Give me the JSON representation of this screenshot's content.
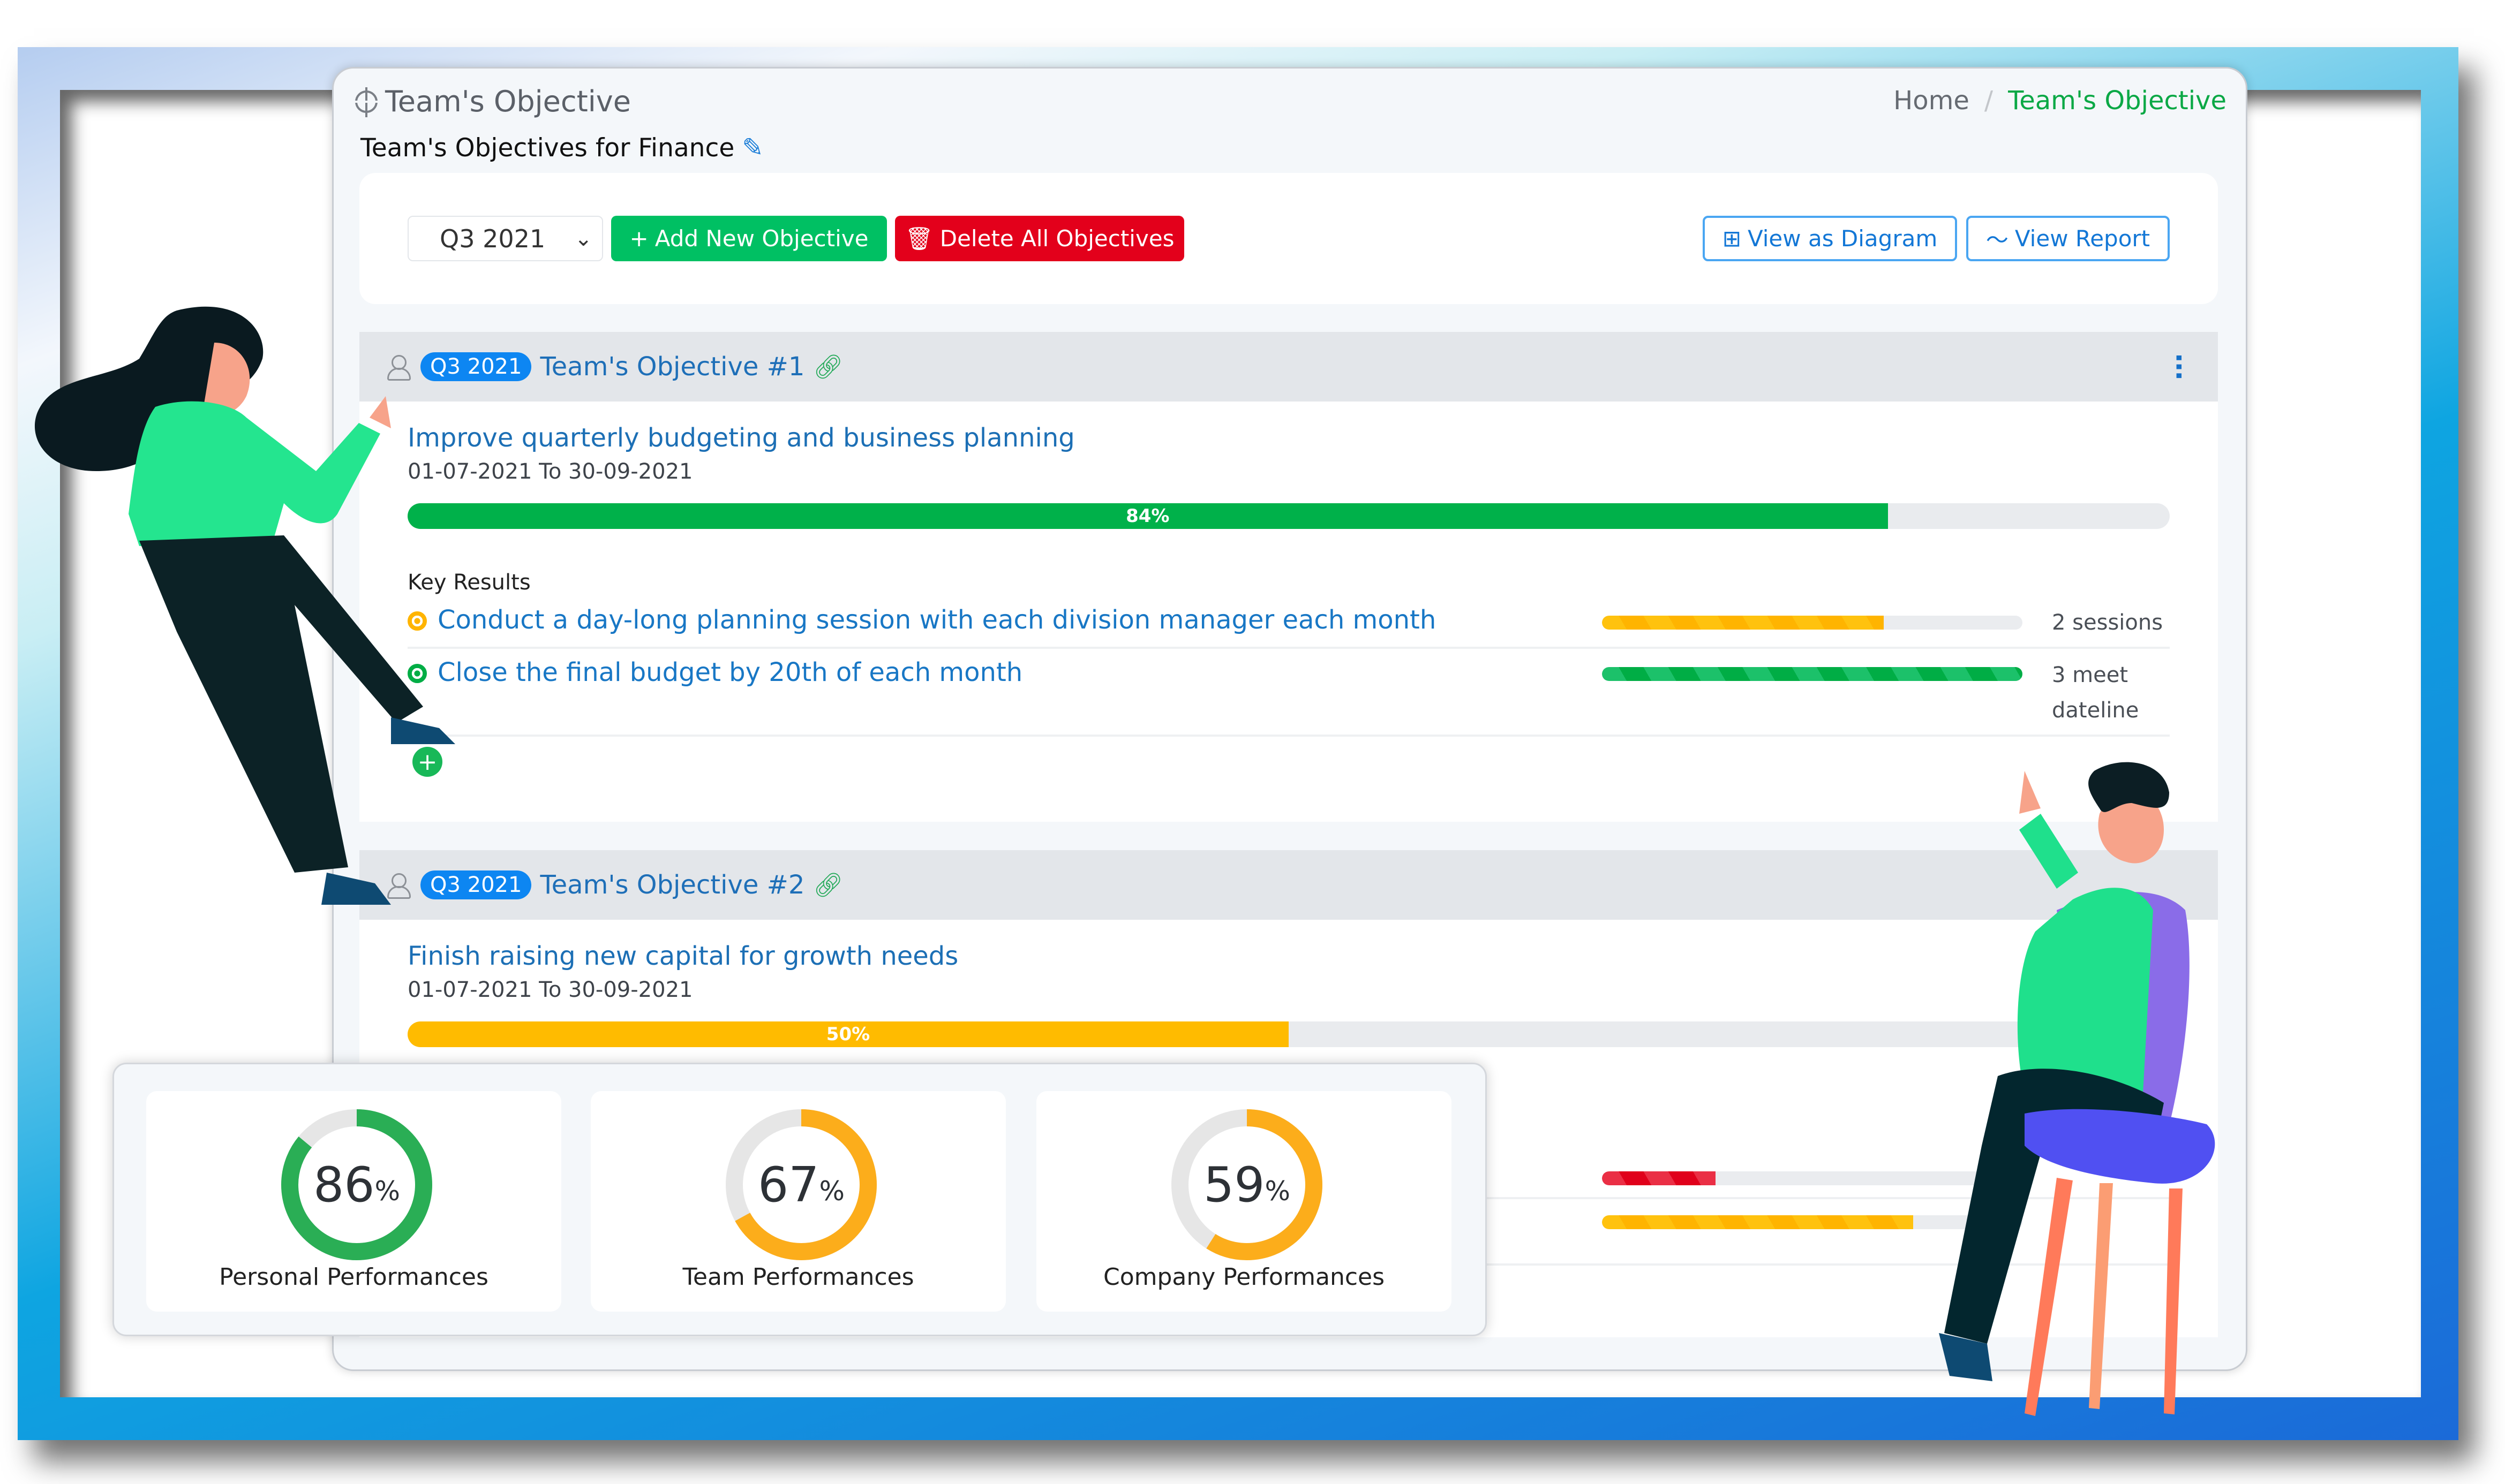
{
  "header": {
    "page_title": "Team's Objective",
    "subtitle": "Team's Objectives for Finance",
    "breadcrumb": {
      "home": "Home",
      "separator": "/",
      "current": "Team's Objective"
    }
  },
  "toolbar": {
    "quarter_select": {
      "selected": "Q3 2021"
    },
    "add_button": "Add New Objective",
    "delete_button": "Delete All Objectives",
    "diagram_button": "View as Diagram",
    "report_button": "View Report"
  },
  "objectives": [
    {
      "badge": "Q3 2021",
      "title": "Team's Objective #1",
      "name": "Improve quarterly budgeting and business planning",
      "dates": "01-07-2021 To 30-09-2021",
      "progress_percent": 84,
      "progress_label": "84%",
      "progress_color": "#00b14a",
      "key_results_label": "Key Results",
      "key_results": [
        {
          "text": "Conduct a day-long planning session with each division manager each month",
          "progress_percent": 67,
          "status_color": "#ffb400",
          "value": "2 sessions"
        },
        {
          "text": "Close the final budget by 20th of each month",
          "progress_percent": 100,
          "status_color": "#00ad45",
          "value": "3 meet dateline"
        }
      ]
    },
    {
      "badge": "Q3 2021",
      "title": "Team's Objective #2",
      "name": "Finish raising new capital for growth needs",
      "dates": "01-07-2021 To 30-09-2021",
      "progress_percent": 50,
      "progress_label": "50%",
      "progress_color": "#ffbb00",
      "key_results": [
        {
          "progress_percent": 27,
          "status_color": "#e0001b"
        },
        {
          "progress_percent": 74,
          "status_color": "#ffb400"
        }
      ]
    }
  ],
  "performance": [
    {
      "value": 86,
      "display": "86",
      "unit": "%",
      "label": "Personal Performances",
      "color": "#2aae55"
    },
    {
      "value": 67,
      "display": "67",
      "unit": "%",
      "label": "Team Performances",
      "color": "#fcad1b"
    },
    {
      "value": 59,
      "display": "59",
      "unit": "%",
      "label": "Company Performances",
      "color": "#fcad1b"
    }
  ],
  "colors": {
    "accent_blue": "#0d86f2",
    "success": "#00c063",
    "danger": "#e3001b",
    "breadcrumb_active": "#0aa845"
  }
}
